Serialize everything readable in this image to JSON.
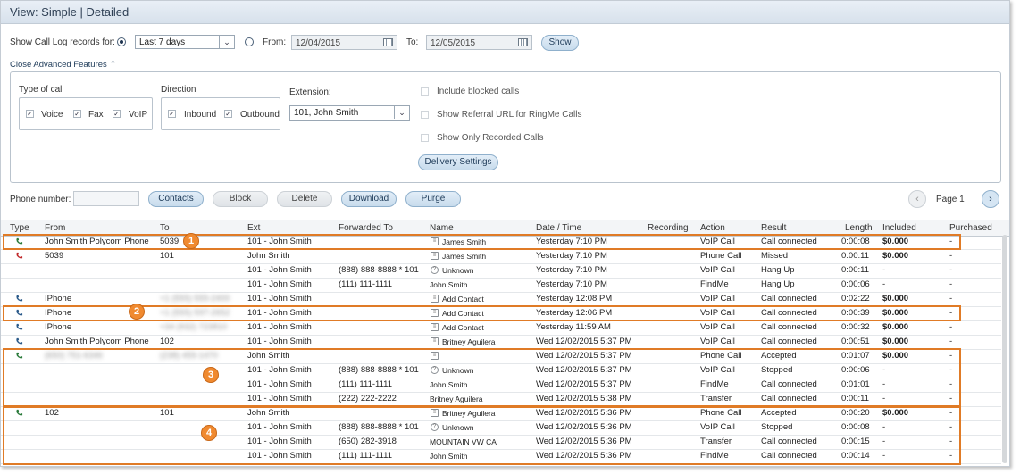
{
  "title": "View: Simple | Detailed",
  "filter": {
    "show_label": "Show Call Log records for:",
    "period_value": "Last 7 days",
    "from_label": "From:",
    "from_value": "12/04/2015",
    "to_label": "To:",
    "to_value": "12/05/2015",
    "show_button": "Show",
    "close_advanced": "Close Advanced Features"
  },
  "advanced": {
    "type_title": "Type of call",
    "types": [
      "Voice",
      "Fax",
      "VoIP"
    ],
    "direction_title": "Direction",
    "directions": [
      "Inbound",
      "Outbound"
    ],
    "extension_label": "Extension:",
    "extension_value": "101, John Smith",
    "options": [
      "Include blocked calls",
      "Show Referral URL for RingMe Calls",
      "Show Only Recorded Calls"
    ],
    "delivery_button": "Delivery Settings"
  },
  "toolbar": {
    "phone_label": "Phone number:",
    "contacts": "Contacts",
    "block": "Block",
    "delete": "Delete",
    "download": "Download",
    "purge": "Purge",
    "page_label": "Page 1"
  },
  "columns": [
    "Type",
    "From",
    "To",
    "Ext",
    "Forwarded To",
    "Name",
    "Date / Time",
    "Recording",
    "Action",
    "Result",
    "Length",
    "Included",
    "Purchased"
  ],
  "rows": [
    {
      "icon": "green",
      "from": "John Smith Polycom Phone",
      "to": "5039",
      "ext": "101 - John Smith",
      "fwd": "",
      "nicon": "card",
      "name": "James Smith",
      "date": "Yesterday 7:10 PM",
      "action": "VoIP Call",
      "result": "Call connected",
      "length": "0:00:08",
      "included": "$0.000",
      "purchased": "-"
    },
    {
      "icon": "red",
      "from": "5039",
      "to": "101",
      "ext": "John Smith",
      "fwd": "",
      "nicon": "card",
      "name": "James Smith",
      "date": "Yesterday 7:10 PM",
      "action": "Phone Call",
      "result": "Missed",
      "length": "0:00:11",
      "included": "$0.000",
      "purchased": "-"
    },
    {
      "icon": "",
      "from": "",
      "to": "",
      "ext": "101 - John Smith",
      "fwd": "(888) 888-8888 * 101",
      "nicon": "q",
      "name": "Unknown",
      "date": "Yesterday 7:10 PM",
      "action": "VoIP Call",
      "result": "Hang Up",
      "length": "0:00:11",
      "included": "-",
      "purchased": "-"
    },
    {
      "icon": "",
      "from": "",
      "to": "",
      "ext": "101 - John Smith",
      "fwd": "(111) 111-1111",
      "nicon": "",
      "name": "John Smith",
      "date": "Yesterday 7:10 PM",
      "action": "FindMe",
      "result": "Hang Up",
      "length": "0:00:06",
      "included": "-",
      "purchased": "-"
    },
    {
      "icon": "blue",
      "from": "IPhone",
      "to": "+1 (555) 555-2400",
      "ext": "101 - John Smith",
      "fwd": "",
      "nicon": "card",
      "name": "Add Contact",
      "date": "Yesterday 12:08 PM",
      "action": "VoIP Call",
      "result": "Call connected",
      "length": "0:02:22",
      "included": "$0.000",
      "purchased": "-"
    },
    {
      "icon": "blue",
      "from": "IPhone",
      "to": "+1 (555) 597-2652",
      "ext": "101 - John Smith",
      "fwd": "",
      "nicon": "card",
      "name": "Add Contact",
      "date": "Yesterday 12:06 PM",
      "action": "VoIP Call",
      "result": "Call connected",
      "length": "0:00:39",
      "included": "$0.000",
      "purchased": "-"
    },
    {
      "icon": "blue",
      "from": "IPhone",
      "to": "+34 (932) 723810",
      "ext": "101 - John Smith",
      "fwd": "",
      "nicon": "card",
      "name": "Add Contact",
      "date": "Yesterday 11:59 AM",
      "action": "VoIP Call",
      "result": "Call connected",
      "length": "0:00:32",
      "included": "$0.000",
      "purchased": "-"
    },
    {
      "icon": "blue",
      "from": "John Smith Polycom Phone",
      "to": "102",
      "ext": "101 - John Smith",
      "fwd": "",
      "nicon": "card",
      "name": "Britney Aguilera",
      "date": "Wed 12/02/2015 5:37 PM",
      "action": "VoIP Call",
      "result": "Call connected",
      "length": "0:00:51",
      "included": "$0.000",
      "purchased": "-"
    },
    {
      "icon": "green",
      "from": "(650) 751-6346",
      "to": "(238) 455-1470",
      "ext": "John Smith",
      "fwd": "",
      "nicon": "card",
      "name": "",
      "date": "Wed 12/02/2015 5:37 PM",
      "action": "Phone Call",
      "result": "Accepted",
      "length": "0:01:07",
      "included": "$0.000",
      "purchased": "-"
    },
    {
      "icon": "",
      "from": "",
      "to": "",
      "ext": "101 - John Smith",
      "fwd": "(888) 888-8888 * 101",
      "nicon": "q",
      "name": "Unknown",
      "date": "Wed 12/02/2015 5:37 PM",
      "action": "VoIP Call",
      "result": "Stopped",
      "length": "0:00:06",
      "included": "-",
      "purchased": "-"
    },
    {
      "icon": "",
      "from": "",
      "to": "",
      "ext": "101 - John Smith",
      "fwd": "(111) 111-1111",
      "nicon": "",
      "name": "John Smith",
      "date": "Wed 12/02/2015 5:37 PM",
      "action": "FindMe",
      "result": "Call connected",
      "length": "0:01:01",
      "included": "-",
      "purchased": "-"
    },
    {
      "icon": "",
      "from": "",
      "to": "",
      "ext": "101 - John Smith",
      "fwd": "(222) 222-2222",
      "nicon": "",
      "name": "Britney Aguilera",
      "date": "Wed 12/02/2015 5:38 PM",
      "action": "Transfer",
      "result": "Call connected",
      "length": "0:00:11",
      "included": "-",
      "purchased": "-"
    },
    {
      "icon": "green",
      "from": "102",
      "to": "101",
      "ext": "John Smith",
      "fwd": "",
      "nicon": "card",
      "name": "Britney Aguilera",
      "date": "Wed 12/02/2015 5:36 PM",
      "action": "Phone Call",
      "result": "Accepted",
      "length": "0:00:20",
      "included": "$0.000",
      "purchased": "-"
    },
    {
      "icon": "",
      "from": "",
      "to": "",
      "ext": "101 - John Smith",
      "fwd": "(888) 888-8888 * 101",
      "nicon": "q",
      "name": "Unknown",
      "date": "Wed 12/02/2015 5:36 PM",
      "action": "VoIP Call",
      "result": "Stopped",
      "length": "0:00:08",
      "included": "-",
      "purchased": "-"
    },
    {
      "icon": "",
      "from": "",
      "to": "",
      "ext": "101 - John Smith",
      "fwd": "(650) 282-3918",
      "nicon": "",
      "name": "MOUNTAIN VW CA",
      "date": "Wed 12/02/2015 5:36 PM",
      "action": "Transfer",
      "result": "Call connected",
      "length": "0:00:15",
      "included": "-",
      "purchased": "-"
    },
    {
      "icon": "",
      "from": "",
      "to": "",
      "ext": "101 - John Smith",
      "fwd": "(111) 111-1111",
      "nicon": "",
      "name": "John Smith",
      "date": "Wed 12/02/2015 5:36 PM",
      "action": "FindMe",
      "result": "Call connected",
      "length": "0:00:14",
      "included": "-",
      "purchased": "-"
    }
  ],
  "callouts": [
    "1",
    "2",
    "3",
    "4"
  ],
  "colors": {
    "accent": "#e07b26",
    "incoming": "#2a7a3a",
    "missed": "#c0282a",
    "outgoing": "#2a5a8a"
  }
}
